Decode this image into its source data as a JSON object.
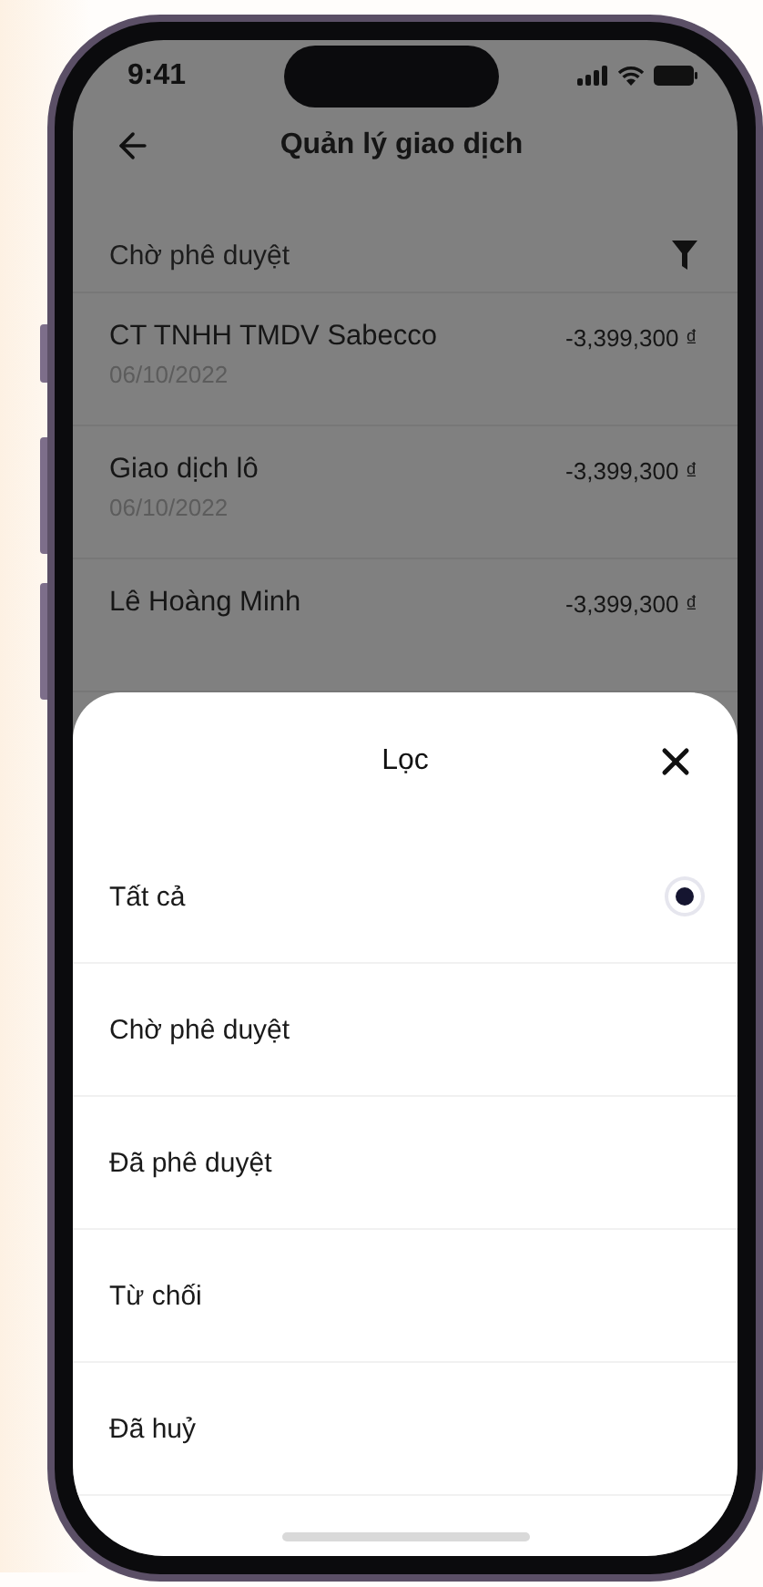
{
  "status_bar": {
    "time": "9:41"
  },
  "header": {
    "title": "Quản lý giao dịch"
  },
  "section": {
    "label": "Chờ phê duyệt"
  },
  "transactions": [
    {
      "name": "CT TNHH TMDV Sabecco",
      "date": "06/10/2022",
      "amount": "-3,399,300 ₫"
    },
    {
      "name": "Giao dịch lô",
      "date": "06/10/2022",
      "amount": "-3,399,300 ₫"
    },
    {
      "name": "Lê Hoàng Minh",
      "amount": "-3,399,300 ₫"
    }
  ],
  "filter_sheet": {
    "title": "Lọc",
    "options": [
      {
        "label": "Tất cả",
        "selected": true
      },
      {
        "label": "Chờ phê duyệt",
        "selected": false
      },
      {
        "label": "Đã phê duyệt",
        "selected": false
      },
      {
        "label": "Từ chối",
        "selected": false
      },
      {
        "label": "Đã huỷ",
        "selected": false
      }
    ]
  }
}
